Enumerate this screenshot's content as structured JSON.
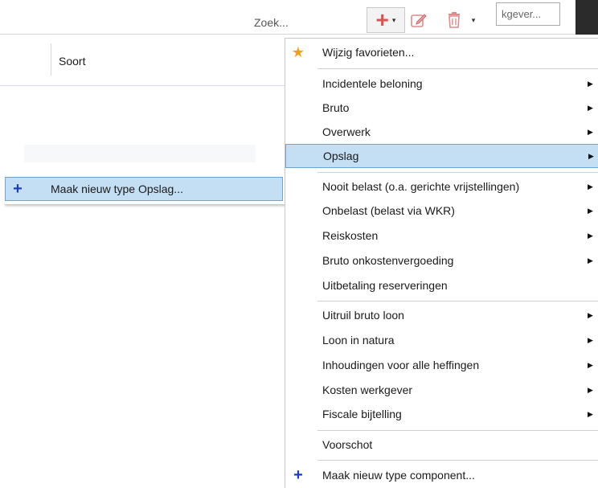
{
  "toolbar": {
    "search_label": "Zoek...",
    "employer_input_value": "kgever...",
    "add_icon": "plus-icon",
    "add_caret": "▾",
    "edit_icon": "edit-icon",
    "delete_icon": "trash-icon",
    "more_caret": "▾"
  },
  "grid": {
    "columns": [
      "Soort"
    ]
  },
  "submenu": {
    "item_label": "Maak nieuw type Opslag...",
    "icon": "plus-icon"
  },
  "menu": {
    "favorites": {
      "label": "Wijzig favorieten...",
      "icon": "star-icon"
    },
    "group1": [
      {
        "label": "Incidentele beloning",
        "arrow": "▶"
      },
      {
        "label": "Bruto",
        "arrow": "▶"
      },
      {
        "label": "Overwerk",
        "arrow": "▶"
      },
      {
        "label": "Opslag",
        "arrow": "▶",
        "selected": true
      }
    ],
    "group2": [
      {
        "label": "Nooit belast (o.a. gerichte vrijstellingen)",
        "arrow": "▶"
      },
      {
        "label": "Onbelast (belast via WKR)",
        "arrow": "▶"
      },
      {
        "label": "Reiskosten",
        "arrow": "▶"
      },
      {
        "label": "Bruto onkostenvergoeding",
        "arrow": "▶"
      },
      {
        "label": "Uitbetaling reserveringen",
        "arrow": ""
      }
    ],
    "group3": [
      {
        "label": "Uitruil bruto loon",
        "arrow": "▶"
      },
      {
        "label": "Loon in natura",
        "arrow": "▶"
      },
      {
        "label": "Inhoudingen voor alle heffingen",
        "arrow": "▶"
      },
      {
        "label": "Kosten werkgever",
        "arrow": "▶"
      },
      {
        "label": "Fiscale bijtelling",
        "arrow": "▶"
      }
    ],
    "advance": {
      "label": "Voorschot"
    },
    "new_component": {
      "label": "Maak nieuw type component...",
      "icon": "plus-icon"
    }
  },
  "colors": {
    "selection_bg": "#c4def4",
    "selection_border": "#6fa3cf",
    "add_red": "#d9534f",
    "plus_blue": "#1a3fbf",
    "star_orange": "#f0a020"
  }
}
